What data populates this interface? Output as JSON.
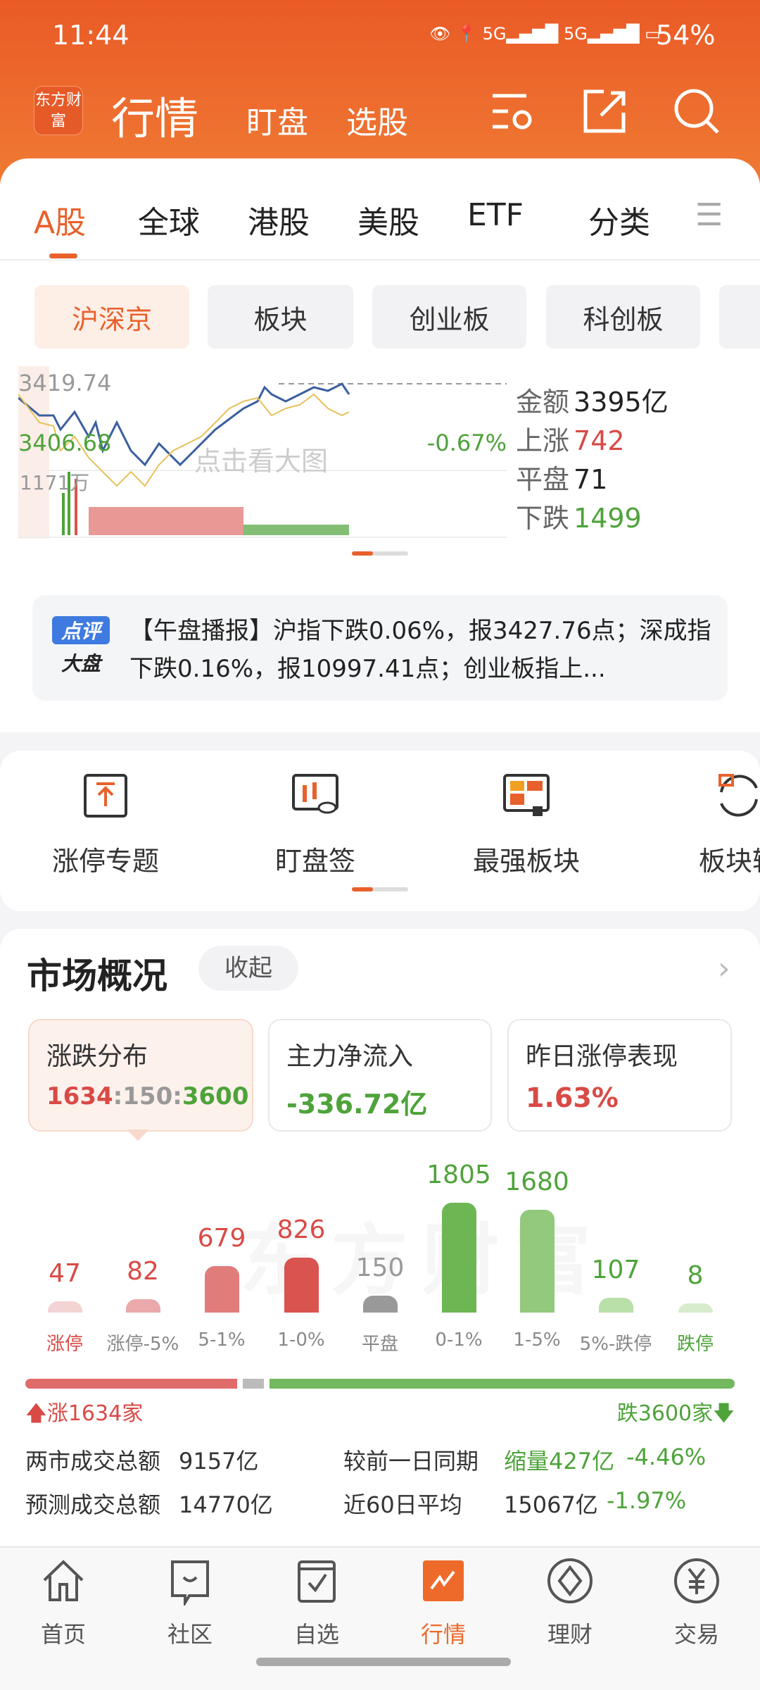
{
  "status": {
    "time": "11:44",
    "battery": "54%",
    "signal1": "5G",
    "signal2": "5G"
  },
  "header": {
    "logo": "东方财富",
    "title": "行情",
    "tabs": [
      "盯盘",
      "选股"
    ],
    "icons": [
      "settings-list-icon",
      "share-icon",
      "search-icon"
    ]
  },
  "market_tabs": [
    {
      "label": "A股",
      "active": true
    },
    {
      "label": "全球"
    },
    {
      "label": "港股"
    },
    {
      "label": "美股"
    },
    {
      "label": "ETF"
    },
    {
      "label": "分类"
    }
  ],
  "sub_tabs": [
    {
      "label": "沪深京",
      "active": true
    },
    {
      "label": "板块"
    },
    {
      "label": "创业板"
    },
    {
      "label": "科创板"
    }
  ],
  "mini_chart": {
    "top_value": "3419.74",
    "low_value": "3406.68",
    "change": "-0.67%",
    "volume": "1171万",
    "overlay": "点击看大图"
  },
  "stats": {
    "amount_label": "金额",
    "amount": "3395亿",
    "up_label": "上涨",
    "up": "742",
    "flat_label": "平盘",
    "flat": "71",
    "down_label": "下跌",
    "down": "1499"
  },
  "news": {
    "badge_top": "点评",
    "badge_bottom": "大盘",
    "text": "【午盘播报】沪指下跌0.06%，报3427.76点；深成指下跌0.16%，报10997.41点；创业板指上..."
  },
  "shortcuts": [
    {
      "label": "涨停专题",
      "icon": "upload-box-icon"
    },
    {
      "label": "盯盘签",
      "icon": "candlestick-eye-icon"
    },
    {
      "label": "最强板块",
      "icon": "blocks-thumb-icon"
    },
    {
      "label": "板块轮",
      "icon": "rotate-icon"
    }
  ],
  "overview": {
    "title": "市场概况",
    "collapse": "收起",
    "boxes": [
      {
        "title": "涨跌分布",
        "up": "1634",
        "flat": "150",
        "down": "3600",
        "sep": ":"
      },
      {
        "title": "主力净流入",
        "value": "-336.72亿"
      },
      {
        "title": "昨日涨停表现",
        "value": "1.63%"
      }
    ],
    "summary": {
      "up": "涨1634家",
      "down": "跌3600家"
    },
    "rows": [
      {
        "label": "两市成交总额",
        "value": "9157亿",
        "label2": "较前一日同期",
        "value2": "缩量427亿",
        "pct": "-4.46%"
      },
      {
        "label": "预测成交总额",
        "value": "14770亿",
        "label2": "近60日平均",
        "value2": "15067亿",
        "pct": "-1.97%"
      }
    ]
  },
  "chart_data": {
    "type": "bar",
    "categories": [
      "涨停",
      "涨停-5%",
      "5-1%",
      "1-0%",
      "平盘",
      "0-1%",
      "1-5%",
      "5%-跌停",
      "跌停"
    ],
    "values": [
      47,
      82,
      679,
      826,
      150,
      1805,
      1680,
      107,
      8
    ],
    "colors": [
      "#f3d3d3",
      "#eaa9ab",
      "#e07d7a",
      "#d9534f",
      "#999999",
      "#6db653",
      "#92c97c",
      "#b9e0a9",
      "#d7eccd"
    ]
  },
  "split_fraction": {
    "up": 1634,
    "flat": 150,
    "down": 3600
  },
  "colors": {
    "accent": "#ee6a2a",
    "up": "#d94a46",
    "down": "#4ea33a"
  },
  "bottom_nav": [
    {
      "label": "首页",
      "icon": "home-icon"
    },
    {
      "label": "社区",
      "icon": "chat-icon"
    },
    {
      "label": "自选",
      "icon": "checkbox-icon"
    },
    {
      "label": "行情",
      "icon": "chart-icon",
      "active": true
    },
    {
      "label": "理财",
      "icon": "diamond-icon"
    },
    {
      "label": "交易",
      "icon": "yen-icon"
    }
  ]
}
